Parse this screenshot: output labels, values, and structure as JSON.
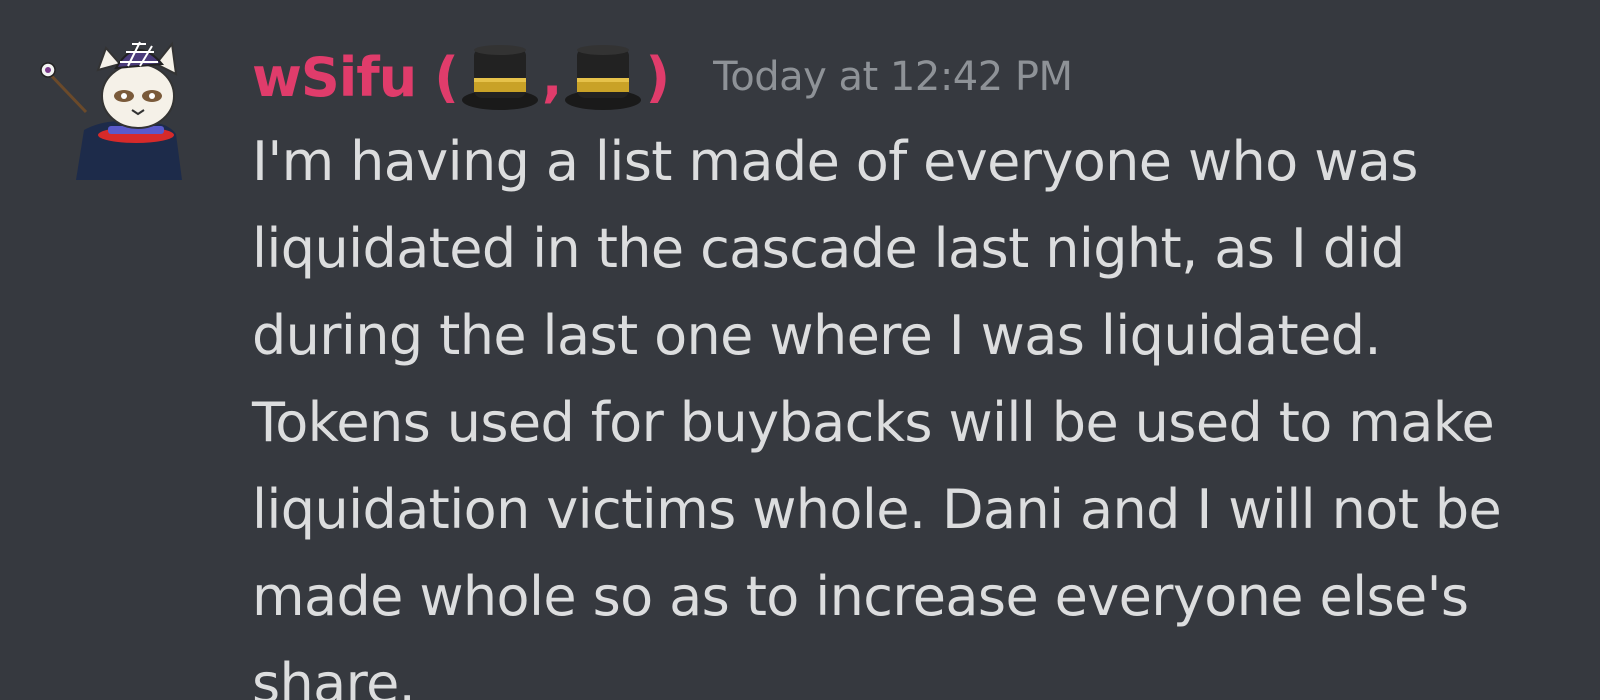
{
  "message": {
    "author": {
      "name": "wSifu",
      "paren_open": "(",
      "separator": ",",
      "paren_close": ")",
      "badges": [
        "top-hat-emoji",
        "top-hat-emoji"
      ],
      "name_color": "#e03c6b"
    },
    "timestamp": "Today at 12:42 PM",
    "lines": [
      "I'm having a list made of everyone who was",
      "liquidated in the cascade last night, as I did",
      "during the last one where I was liquidated.",
      "Tokens used for buybacks will be used to make",
      "liquidation victims whole. Dani and I will not be",
      "made whole so as to increase everyone else's",
      "share."
    ]
  },
  "theme": {
    "background": "#36393f",
    "text": "#dcddde",
    "timestamp": "#8e9297"
  }
}
